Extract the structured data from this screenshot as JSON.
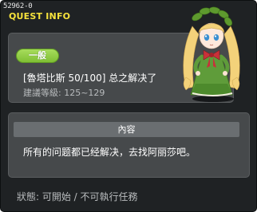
{
  "window": {
    "quest_id": "52962-0",
    "title": "QUEST INFO"
  },
  "info": {
    "badge": "一般",
    "quest_name": "[魯塔比斯 50/100] 总之解决了",
    "level_text": "建議等級: 125~129"
  },
  "content": {
    "header": "內容",
    "text": "所有的问题都已经解决，去找阿丽莎吧。"
  },
  "status": {
    "text": "狀態: 可開始 / 不可執行任務"
  },
  "npc": {
    "icon": "npc-girl-green-dress"
  }
}
